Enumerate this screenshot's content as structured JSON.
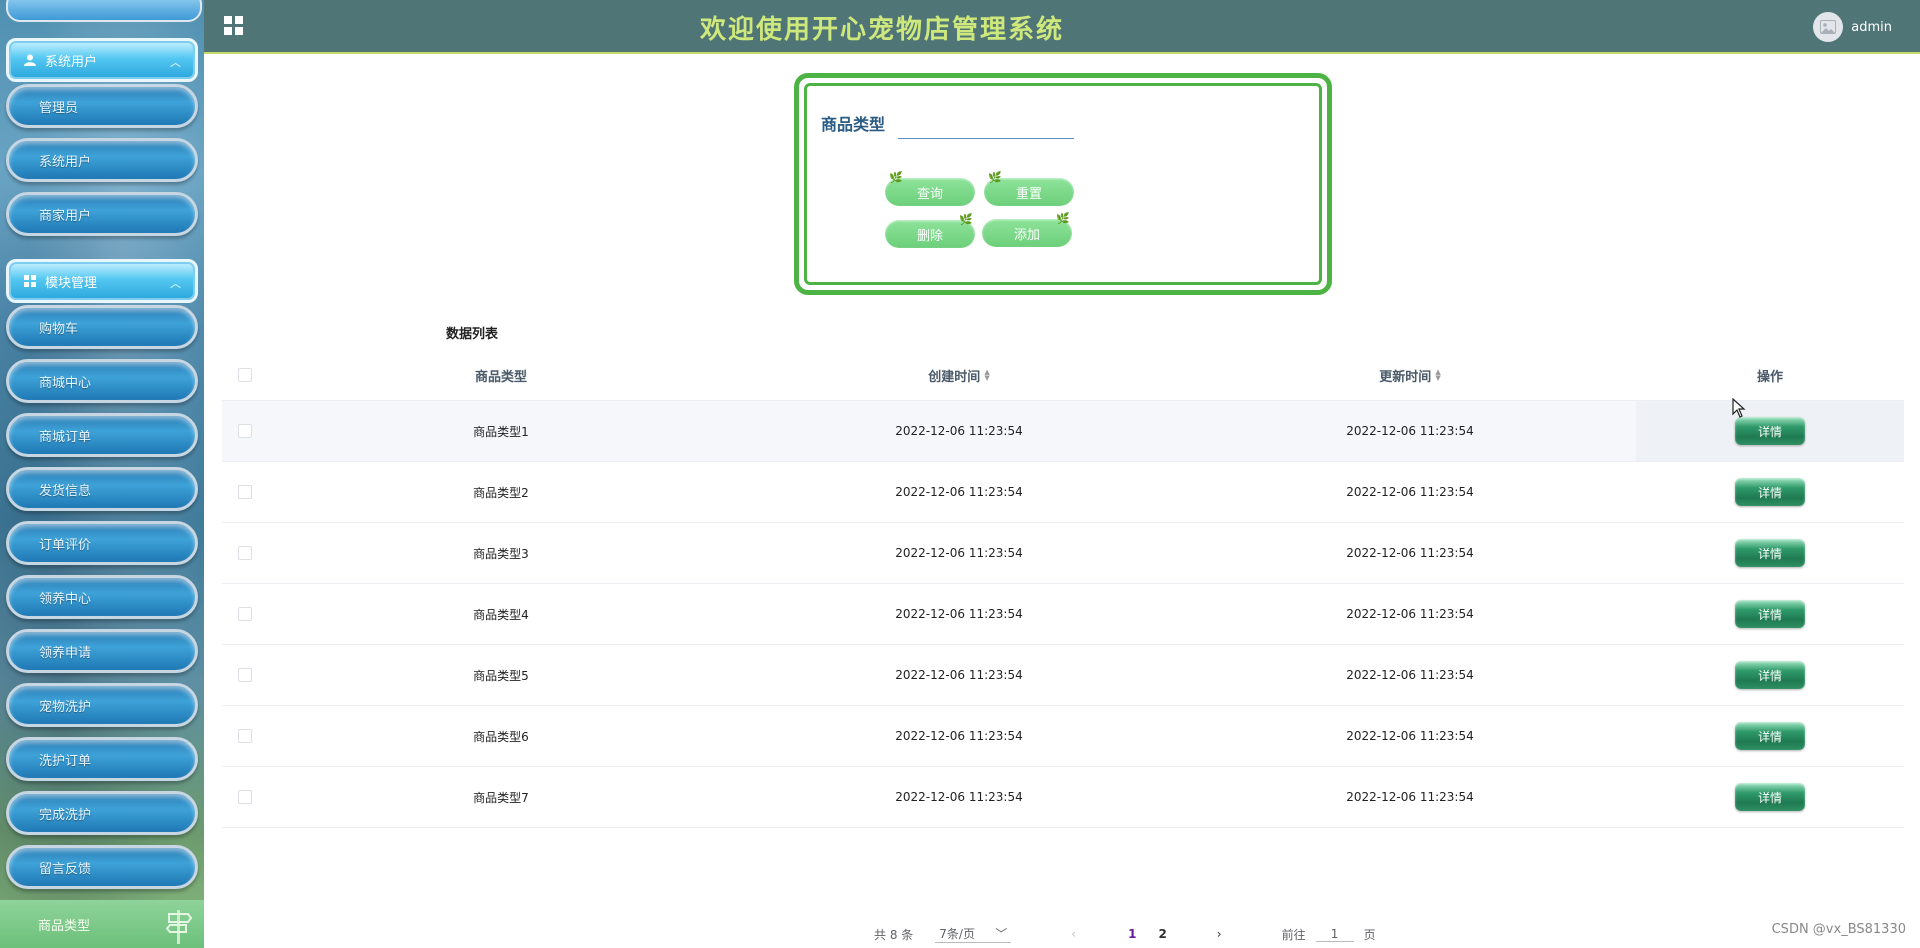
{
  "header": {
    "title": "欢迎使用开心宠物店管理系统",
    "username": "admin"
  },
  "sidebar": {
    "groups": [
      {
        "label": "系统用户",
        "items": [
          "管理员",
          "系统用户",
          "商家用户"
        ]
      },
      {
        "label": "模块管理",
        "items": [
          "购物车",
          "商城中心",
          "商城订单",
          "发货信息",
          "订单评价",
          "领养中心",
          "领养申请",
          "宠物洗护",
          "洗护订单",
          "完成洗护",
          "留言反馈"
        ]
      }
    ],
    "active_item": "商品类型"
  },
  "search": {
    "label": "商品类型",
    "value": "",
    "buttons": {
      "query": "查询",
      "reset": "重置",
      "delete": "删除",
      "add": "添加"
    }
  },
  "table": {
    "title": "数据列表",
    "columns": {
      "type": "商品类型",
      "created": "创建时间",
      "updated": "更新时间",
      "op": "操作"
    },
    "rows": [
      {
        "type": "商品类型1",
        "created": "2022-12-06 11:23:54",
        "updated": "2022-12-06 11:23:54",
        "action": "详情"
      },
      {
        "type": "商品类型2",
        "created": "2022-12-06 11:23:54",
        "updated": "2022-12-06 11:23:54",
        "action": "详情"
      },
      {
        "type": "商品类型3",
        "created": "2022-12-06 11:23:54",
        "updated": "2022-12-06 11:23:54",
        "action": "详情"
      },
      {
        "type": "商品类型4",
        "created": "2022-12-06 11:23:54",
        "updated": "2022-12-06 11:23:54",
        "action": "详情"
      },
      {
        "type": "商品类型5",
        "created": "2022-12-06 11:23:54",
        "updated": "2022-12-06 11:23:54",
        "action": "详情"
      },
      {
        "type": "商品类型6",
        "created": "2022-12-06 11:23:54",
        "updated": "2022-12-06 11:23:54",
        "action": "详情"
      },
      {
        "type": "商品类型7",
        "created": "2022-12-06 11:23:54",
        "updated": "2022-12-06 11:23:54",
        "action": "详情"
      }
    ]
  },
  "pagination": {
    "total": "共 8 条",
    "page_size": "7条/页",
    "pages": [
      "1",
      "2"
    ],
    "current": "1",
    "goto_label": "前往",
    "goto_value": "1",
    "goto_unit": "页"
  },
  "watermark": "CSDN @vx_BS81330",
  "colors": {
    "header_bg": "#4f7577",
    "title": "#cfe87c",
    "panel_border": "#4db344",
    "detail_btn": "#2f9a6a"
  }
}
